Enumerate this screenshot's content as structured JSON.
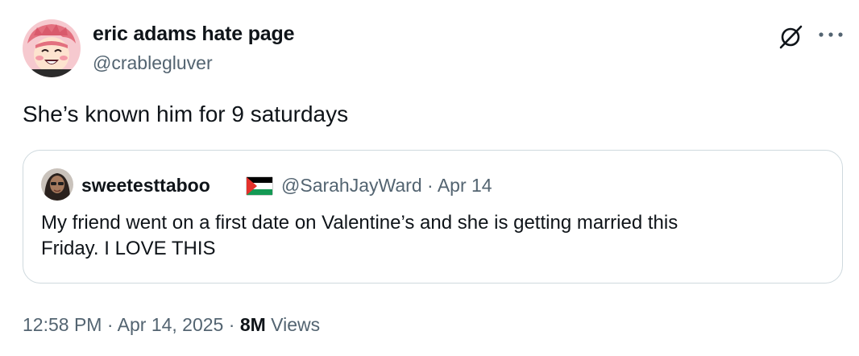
{
  "tweet": {
    "author_name": "eric adams hate page",
    "author_handle": "@crablegluver",
    "text": "She’s known him for 9 saturdays",
    "time": "12:58 PM",
    "date": "Apr 14, 2025",
    "separator": "·",
    "views_count": "8M",
    "views_label": "Views"
  },
  "quote": {
    "author_name": "sweetesttaboo",
    "author_handle": "@SarahJayWard",
    "date": "Apr 14",
    "separator": "·",
    "text_line1": "My friend went on a first date on Valentine’s and she is getting married this",
    "text_line2": "Friday. I LOVE THIS",
    "flag": "palestine-flag"
  },
  "icons": {
    "grok": "grok-icon",
    "more": "more-options-icon"
  },
  "colors": {
    "text_primary": "#0f1419",
    "text_secondary": "#536471",
    "border": "#cfd9de"
  }
}
